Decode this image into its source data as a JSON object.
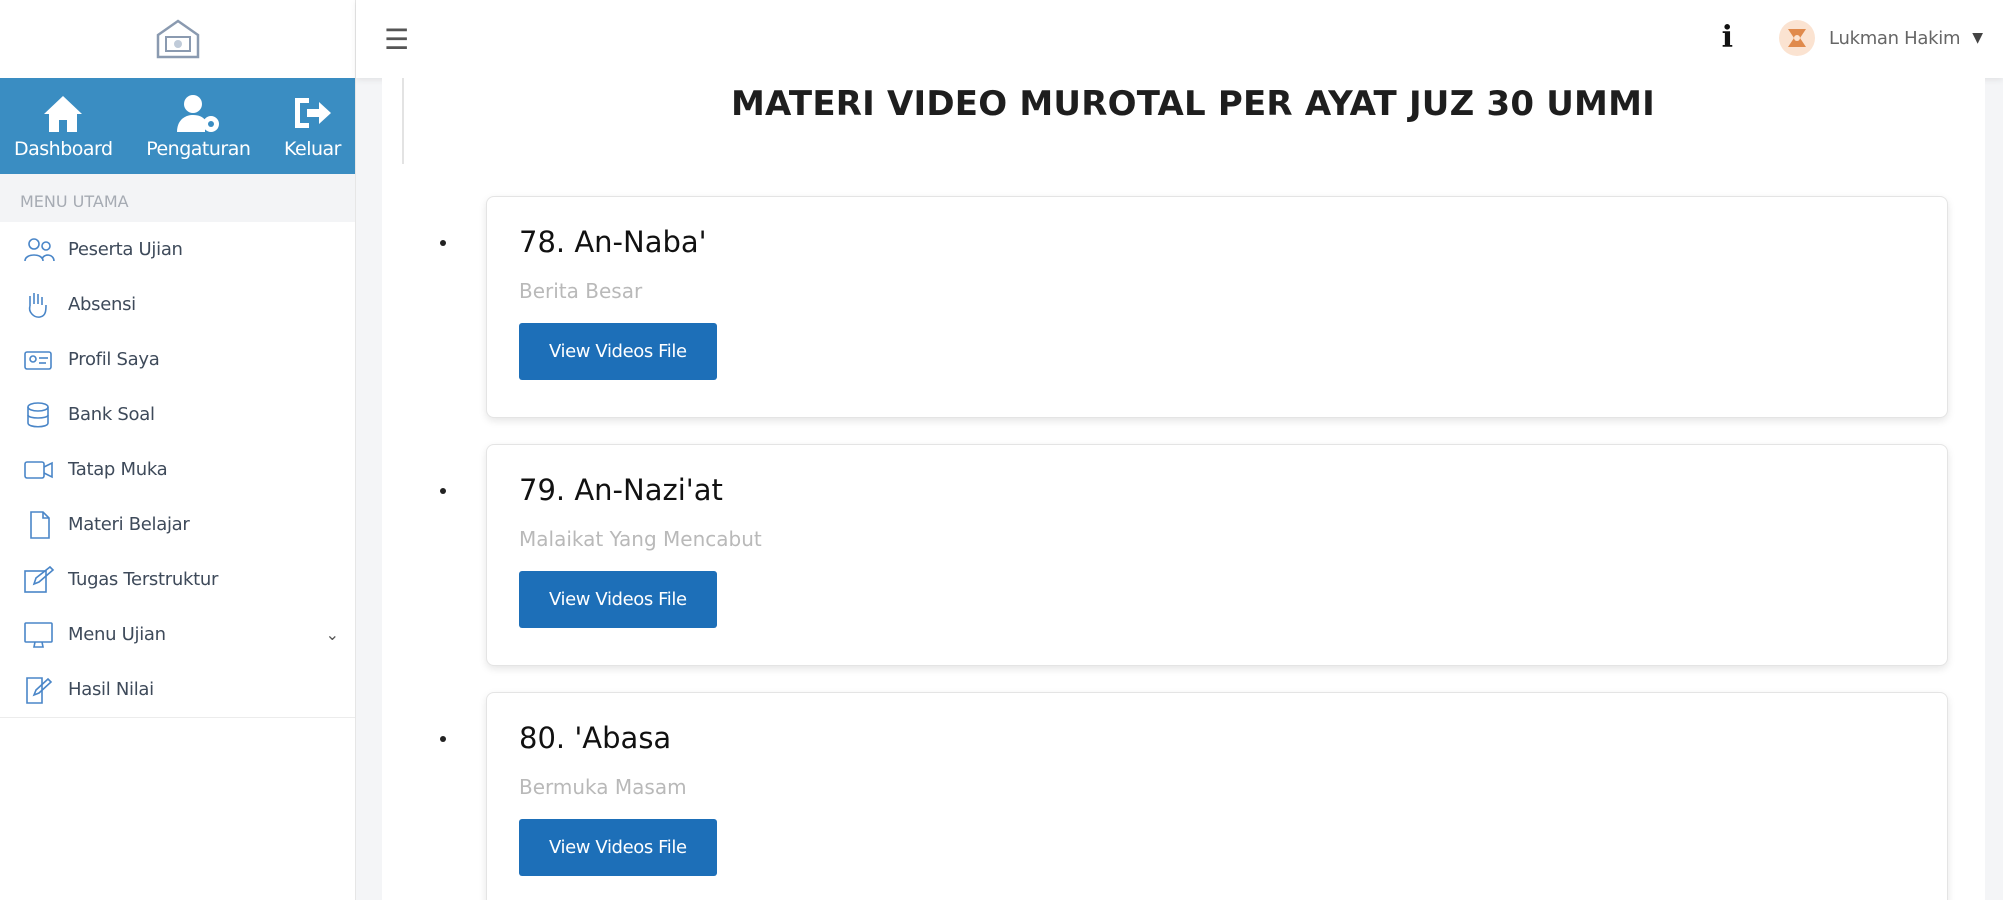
{
  "sidebar": {
    "quick": [
      {
        "label": "Dashboard",
        "icon": "home-icon"
      },
      {
        "label": "Pengaturan",
        "icon": "user-gear-icon"
      },
      {
        "label": "Keluar",
        "icon": "logout-icon"
      }
    ],
    "menu_header": "MENU UTAMA",
    "items": [
      {
        "label": "Peserta Ujian",
        "icon": "users-icon"
      },
      {
        "label": "Absensi",
        "icon": "hand-icon"
      },
      {
        "label": "Profil Saya",
        "icon": "profile-card-icon"
      },
      {
        "label": "Bank Soal",
        "icon": "database-icon"
      },
      {
        "label": "Tatap Muka",
        "icon": "video-camera-icon"
      },
      {
        "label": "Materi Belajar",
        "icon": "document-icon"
      },
      {
        "label": "Tugas Terstruktur",
        "icon": "edit-icon"
      },
      {
        "label": "Menu Ujian",
        "icon": "monitor-icon"
      },
      {
        "label": "Hasil Nilai",
        "icon": "report-icon"
      }
    ]
  },
  "topbar": {
    "user_name": "Lukman Hakim"
  },
  "main": {
    "title": "MATERI VIDEO MUROTAL PER AYAT JUZ 30 UMMI",
    "cards": [
      {
        "title": "78. An-Naba'",
        "subtitle": "Berita Besar",
        "button": "View Videos File"
      },
      {
        "title": "79. An-Nazi'at",
        "subtitle": "Malaikat Yang Mencabut",
        "button": "View Videos File"
      },
      {
        "title": "80. 'Abasa",
        "subtitle": "Bermuka Masam",
        "button": "View Videos File"
      }
    ]
  },
  "colors": {
    "sidebar_accent": "#3a8dc2",
    "button_primary": "#1d6fb8",
    "menu_icon": "#4a86c8"
  }
}
